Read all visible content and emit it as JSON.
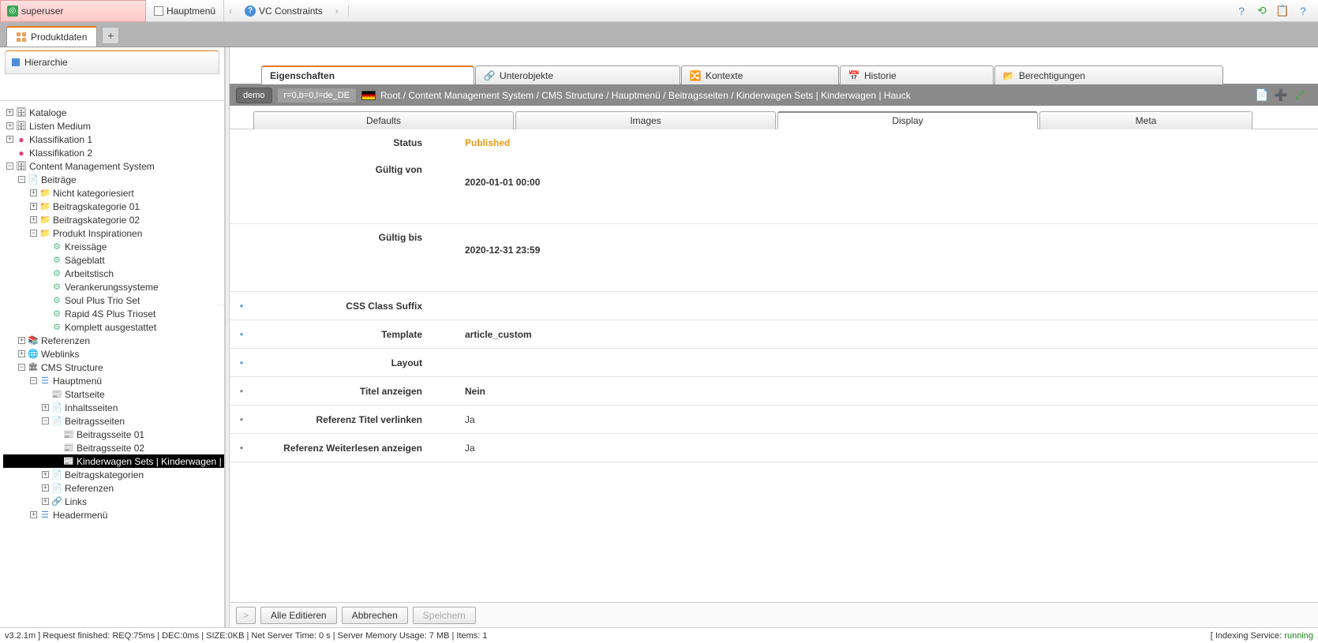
{
  "topBar": {
    "user": "superuser",
    "tab1": "Hauptmenü",
    "tab2": "VC Constraints"
  },
  "mainTab": "Produktdaten",
  "leftHeader": "Hierarchie",
  "tree": {
    "kataloge": "Kataloge",
    "listen": "Listen Medium",
    "klass1": "Klassifikation 1",
    "klass2": "Klassifikation 2",
    "cms": "Content Management System",
    "beitraege": "Beiträge",
    "nicht": "Nicht kategoriesiert",
    "bkat01": "Beitragskategorie 01",
    "bkat02": "Beitragskategorie 02",
    "prodinsp": "Produkt Inspirationen",
    "kreissaege": "Kreissäge",
    "saegeblatt": "Sägeblatt",
    "arbeitstisch": "Arbeitstisch",
    "verankerung": "Verankerungssysteme",
    "soul": "Soul Plus Trio Set",
    "rapid": "Rapid 4S Plus Trioset",
    "komplett": "Komplett ausgestattet",
    "referenzen": "Referenzen",
    "weblinks": "Weblinks",
    "cmsstruct": "CMS Structure",
    "hauptmenu": "Hauptmenü",
    "startseite": "Startseite",
    "inhaltsseiten": "Inhaltsseiten",
    "beitragsseiten": "Beitragsseiten",
    "bseite01": "Beitragsseite 01",
    "bseite02": "Beitragsseite 02",
    "kinderwagen": "Kinderwagen Sets | Kinderwagen | ...",
    "beitragskat": "Beitragskategorien",
    "referenzen2": "Referenzen",
    "links": "Links",
    "headermenu": "Headermenü"
  },
  "detailTabs": {
    "eigenschaften": "Eigenschaften",
    "unterobjekte": "Unterobjekte",
    "kontexte": "Kontexte",
    "historie": "Historie",
    "berechtigungen": "Berechtigungen"
  },
  "breadcrumb": {
    "demo": "demo",
    "rev": "r=0,b=0,l=de_DE",
    "path": "Root / Content Management System / CMS Structure / Hauptmenü / Beitragsseiten / Kinderwagen Sets | Kinderwagen | Hauck"
  },
  "subTabs": {
    "defaults": "Defaults",
    "images": "Images",
    "display": "Display",
    "meta": "Meta"
  },
  "form": {
    "statusLabel": "Status",
    "statusValue": "Published",
    "validFromLabel": "Gültig von",
    "validFromValue": "2020-01-01 00:00",
    "validToLabel": "Gültig bis",
    "validToValue": "2020-12-31 23:59",
    "cssSuffixLabel": "CSS Class Suffix",
    "cssSuffixValue": "",
    "templateLabel": "Template",
    "templateValue": "article_custom",
    "layoutLabel": "Layout",
    "layoutValue": "",
    "titelLabel": "Titel anzeigen",
    "titelValue": "Nein",
    "refTitelLabel": "Referenz Titel verlinken",
    "refTitelValue": "Ja",
    "refWeiterLabel": "Referenz Weiterlesen anzeigen",
    "refWeiterValue": "Ja"
  },
  "buttons": {
    "alleEditieren": "Alle Editieren",
    "abbrechen": "Abbrechen",
    "speichern": "Speichern"
  },
  "statusBar": {
    "left": "v3.2.1m ] Request finished: REQ:75ms | DEC:0ms | SIZE:0KB | Net Server Time: 0 s | Server Memory Usage: 7 MB | Items: 1",
    "rightPrefix": "[ Indexing Service: ",
    "rightStatus": "running"
  }
}
